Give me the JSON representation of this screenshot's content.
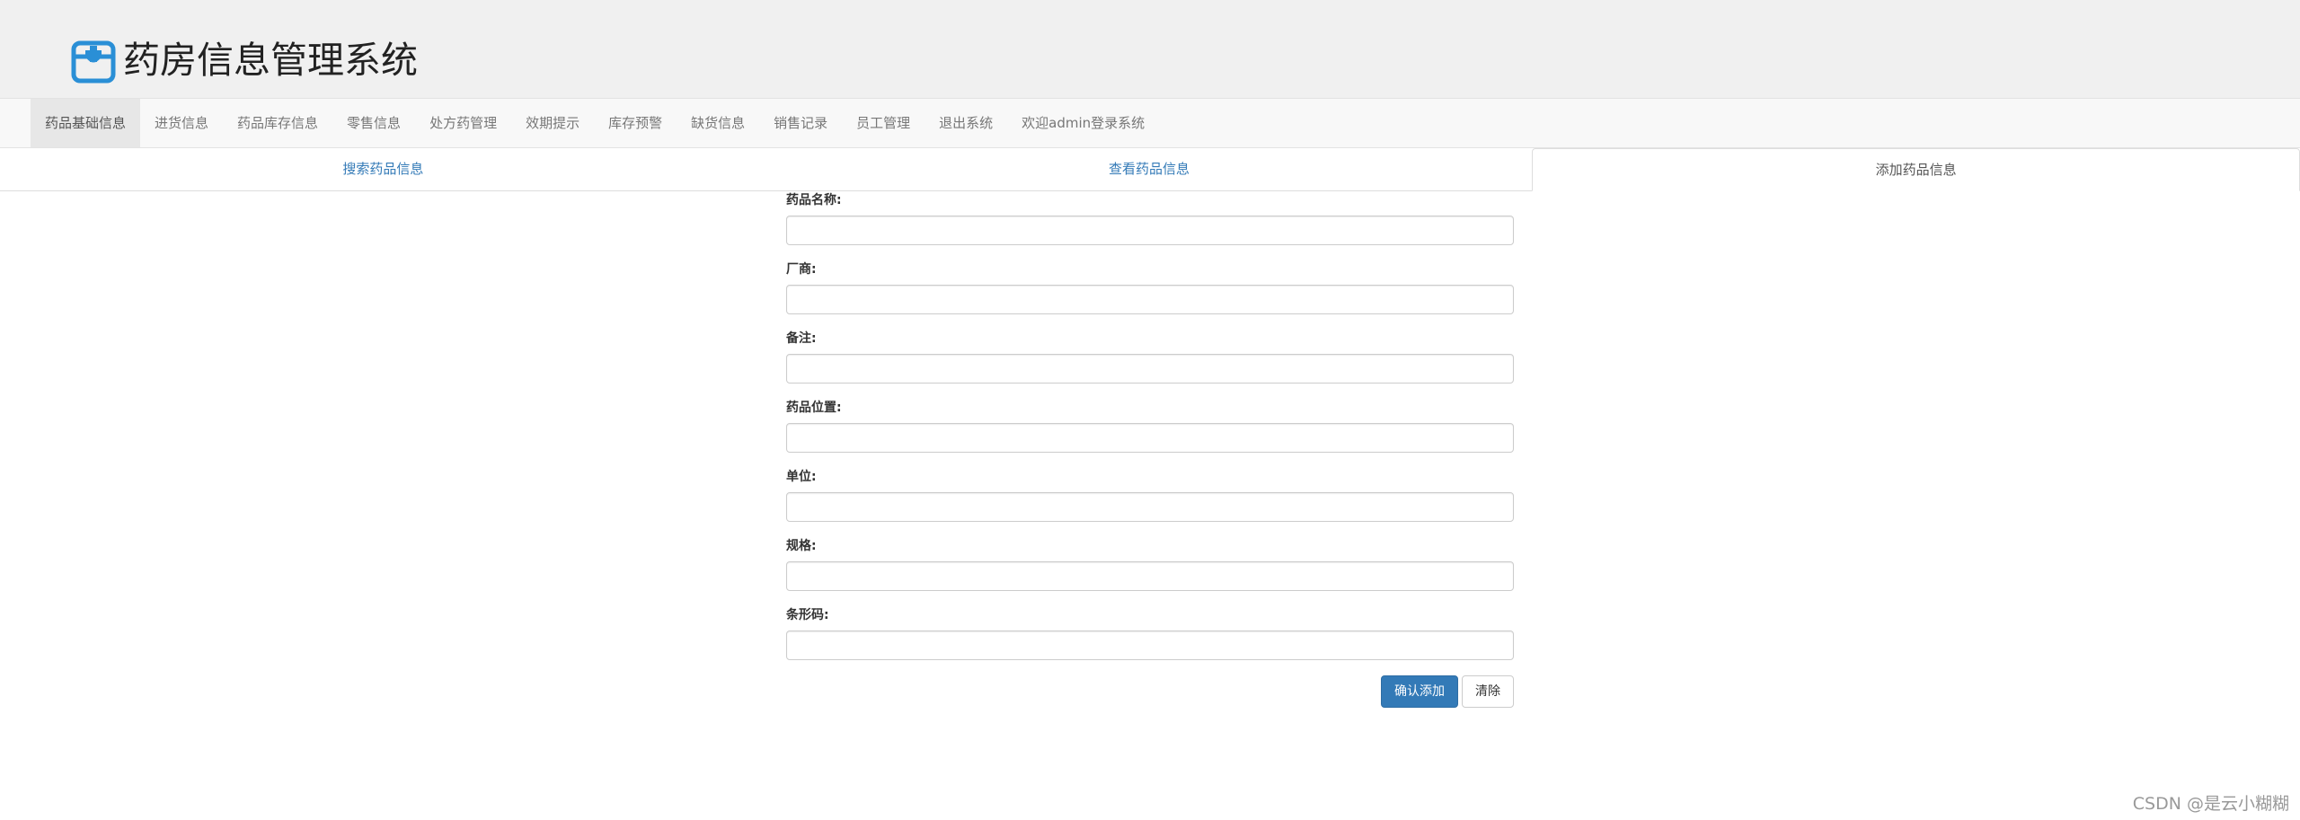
{
  "header": {
    "title": "药房信息管理系统",
    "logo_icon": "medicine-box-icon",
    "logo_color": "#2a8fd6"
  },
  "navbar": {
    "items": [
      {
        "label": "药品基础信息",
        "active": true
      },
      {
        "label": "进货信息"
      },
      {
        "label": "药品库存信息"
      },
      {
        "label": "零售信息"
      },
      {
        "label": "处方药管理"
      },
      {
        "label": "效期提示"
      },
      {
        "label": "库存预警"
      },
      {
        "label": "缺货信息"
      },
      {
        "label": "销售记录"
      },
      {
        "label": "员工管理"
      },
      {
        "label": "退出系统"
      },
      {
        "label": "欢迎admin登录系统"
      }
    ]
  },
  "tabs": [
    {
      "label": "搜索药品信息"
    },
    {
      "label": "查看药品信息"
    },
    {
      "label": "添加药品信息",
      "active": true
    }
  ],
  "form": {
    "fields": [
      {
        "label": "药品名称:",
        "value": ""
      },
      {
        "label": "厂商:",
        "value": ""
      },
      {
        "label": "备注:",
        "value": ""
      },
      {
        "label": "药品位置:",
        "value": ""
      },
      {
        "label": "单位:",
        "value": ""
      },
      {
        "label": "规格:",
        "value": ""
      },
      {
        "label": "条形码:",
        "value": ""
      }
    ],
    "submit_label": "确认添加",
    "reset_label": "清除"
  },
  "colors": {
    "primary": "#337ab7",
    "link": "#337ab7"
  },
  "watermark": "CSDN @是云小糊糊"
}
